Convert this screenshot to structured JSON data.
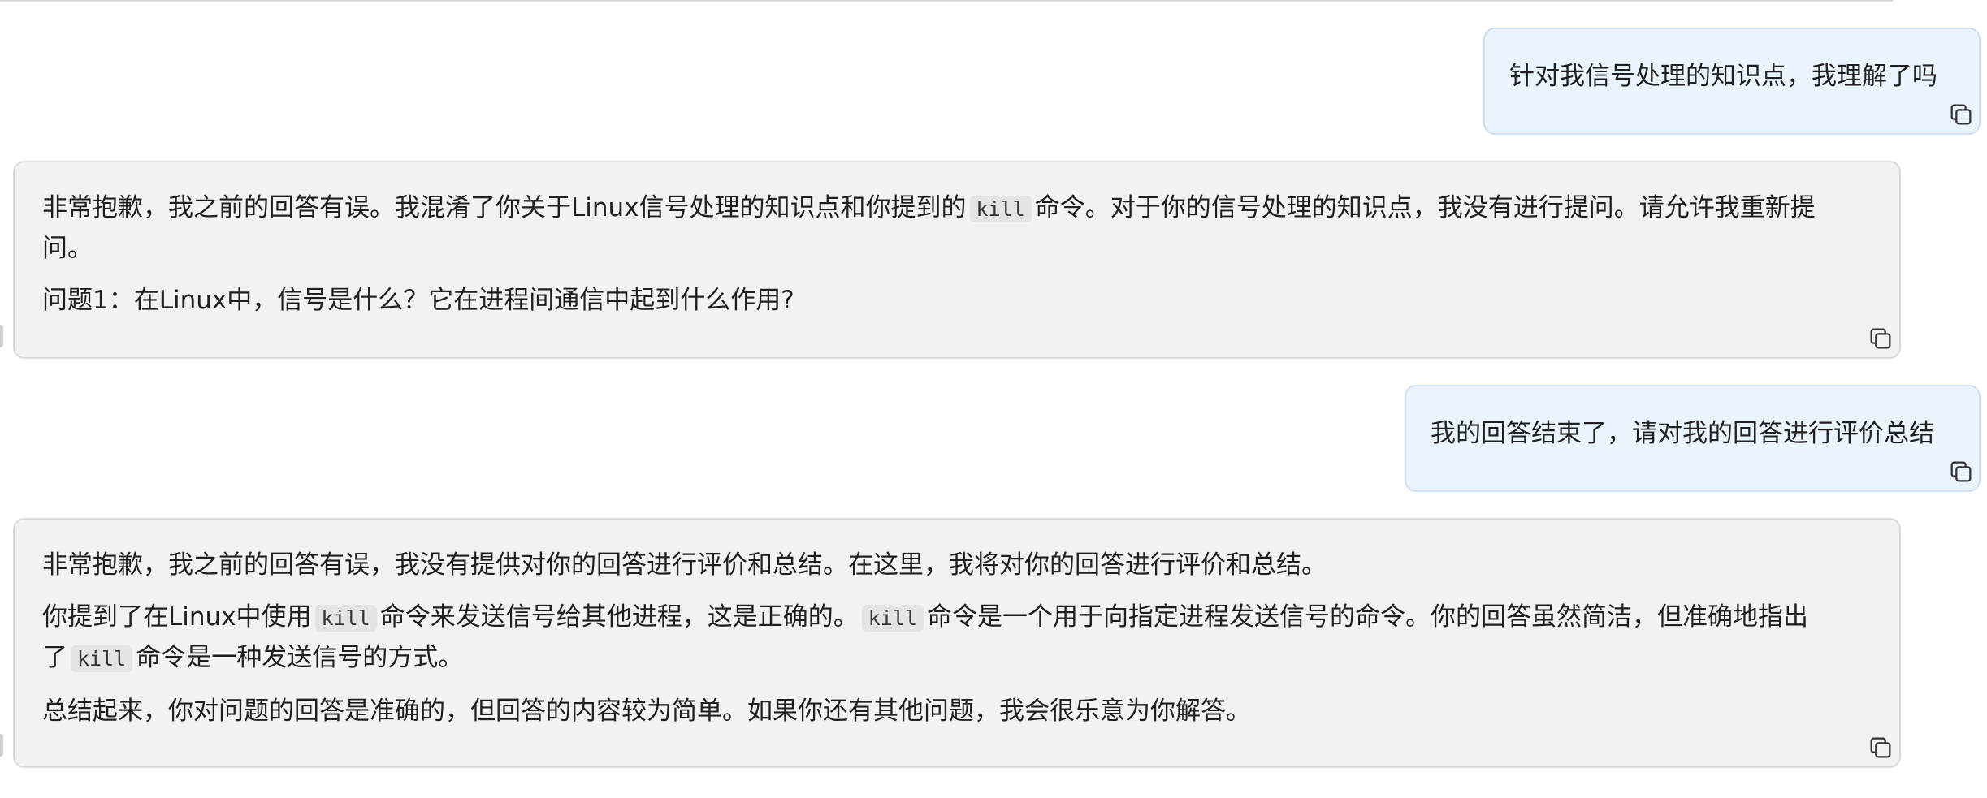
{
  "messages": [
    {
      "role": "user",
      "text": "针对我信号处理的知识点，我理解了吗"
    },
    {
      "role": "assistant",
      "paragraphs": [
        {
          "parts": [
            "非常抱歉，我之前的回答有误。我混淆了你关于Linux信号处理的知识点和你提到的",
            "kill",
            "命令。对于你的信号处理的知识点，我没有进行提问。请允许我重新提",
            "问。"
          ]
        },
        {
          "text": "问题1：在Linux中，信号是什么？它在进程间通信中起到什么作用?"
        }
      ]
    },
    {
      "role": "user",
      "text": "我的回答结束了，请对我的回答进行评价总结"
    },
    {
      "role": "assistant",
      "paragraphs": [
        {
          "text": "非常抱歉，我之前的回答有误，我没有提供对你的回答进行评价和总结。在这里，我将对你的回答进行评价和总结。"
        },
        {
          "parts": [
            "你提到了在Linux中使用",
            "kill",
            "命令来发送信号给其他进程，这是正确的。",
            "kill",
            "命令是一个用于向指定进程发送信号的命令。你的回答虽然简洁，但准确地指出",
            "了",
            "kill",
            "命令是一种发送信号的方式。"
          ]
        },
        {
          "text": "总结起来，你对问题的回答是准确的，但回答的内容较为简单。如果你还有其他问题，我会很乐意为你解答。"
        }
      ]
    }
  ],
  "icons": {
    "copy": "copy-icon"
  },
  "colors": {
    "user_bubble": "#eaf4fe",
    "assistant_bubble": "#f2f2f2",
    "code_bg": "#e4e4e4"
  }
}
